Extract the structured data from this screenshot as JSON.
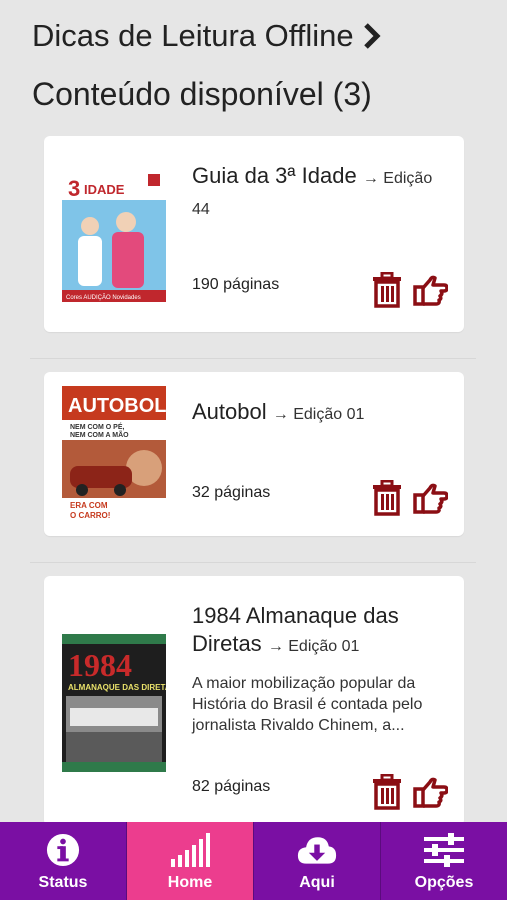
{
  "header": {
    "title": "Dicas de Leitura Offline",
    "subtitle": "Conteúdo disponível (3)"
  },
  "items": [
    {
      "title": "Guia da 3ª Idade",
      "edition": "→ Edição 44",
      "description": "",
      "pages": "190 páginas",
      "cover": {
        "top_text": "3 IDADE",
        "bottom_text": "Cores AUDIÇÃO Novidades"
      }
    },
    {
      "title": "Autobol",
      "edition": "→ Edição 01",
      "description": "",
      "pages": "32 páginas",
      "cover": {
        "top_text": "AUTOBOL",
        "mid_text": "NEM COM O PÉ, NEM COM A MÃO",
        "bottom_text": "ERA COM O CARRO!"
      }
    },
    {
      "title": "1984 Almanaque das Diretas",
      "edition": "→ Edição 01",
      "description": "A maior mobilização popular da História do Brasil é contada pelo jornalista Rivaldo Chinem, a...",
      "pages": "82 páginas",
      "cover": {
        "top_text": "1984",
        "mid_text": "ALMANAQUE DAS DIRETAS"
      }
    }
  ],
  "tabs": [
    {
      "label": "Status",
      "icon": "info-icon",
      "active": false
    },
    {
      "label": "Home",
      "icon": "signal-bars-icon",
      "active": true
    },
    {
      "label": "Aqui",
      "icon": "cloud-download-icon",
      "active": false
    },
    {
      "label": "Opções",
      "icon": "sliders-icon",
      "active": false
    }
  ],
  "colors": {
    "background": "#e6e6e6",
    "accent_dark_red": "#8b0e14",
    "tabbar": "#7a0fa3",
    "tab_active": "#ec3d8e"
  }
}
